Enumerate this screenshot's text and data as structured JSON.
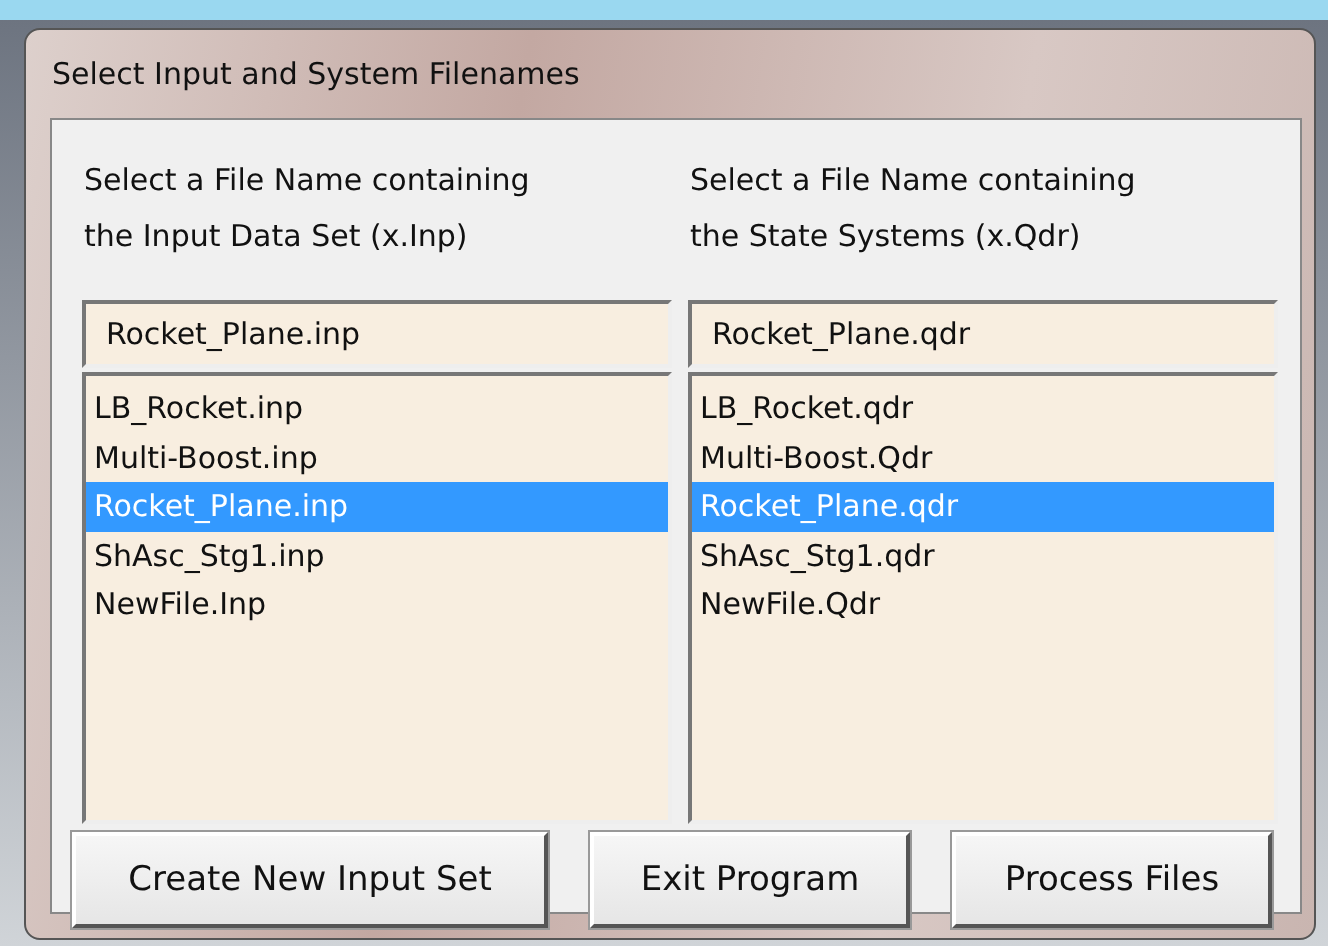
{
  "window": {
    "title": "Select Input and System Filenames"
  },
  "columns": [
    {
      "label_lines": [
        "Select a File Name containing",
        "the Input Data Set (x.Inp)"
      ],
      "field": {
        "value": "Rocket_Plane.inp"
      },
      "files": [
        {
          "name": "LB_Rocket.inp",
          "selected": false
        },
        {
          "name": "Multi-Boost.inp",
          "selected": false
        },
        {
          "name": "Rocket_Plane.inp",
          "selected": true
        },
        {
          "name": "ShAsc_Stg1.inp",
          "selected": false
        },
        {
          "name": "NewFile.Inp",
          "selected": false
        }
      ]
    },
    {
      "label_lines": [
        "Select a File Name containing",
        "the State Systems (x.Qdr)"
      ],
      "field": {
        "value": "Rocket_Plane.qdr"
      },
      "files": [
        {
          "name": "LB_Rocket.qdr",
          "selected": false
        },
        {
          "name": "Multi-Boost.Qdr",
          "selected": false
        },
        {
          "name": "Rocket_Plane.qdr",
          "selected": true
        },
        {
          "name": "ShAsc_Stg1.qdr",
          "selected": false
        },
        {
          "name": "NewFile.Qdr",
          "selected": false
        }
      ]
    }
  ],
  "buttons": [
    "Create New Input Set",
    "Exit Program",
    "Process Files"
  ]
}
